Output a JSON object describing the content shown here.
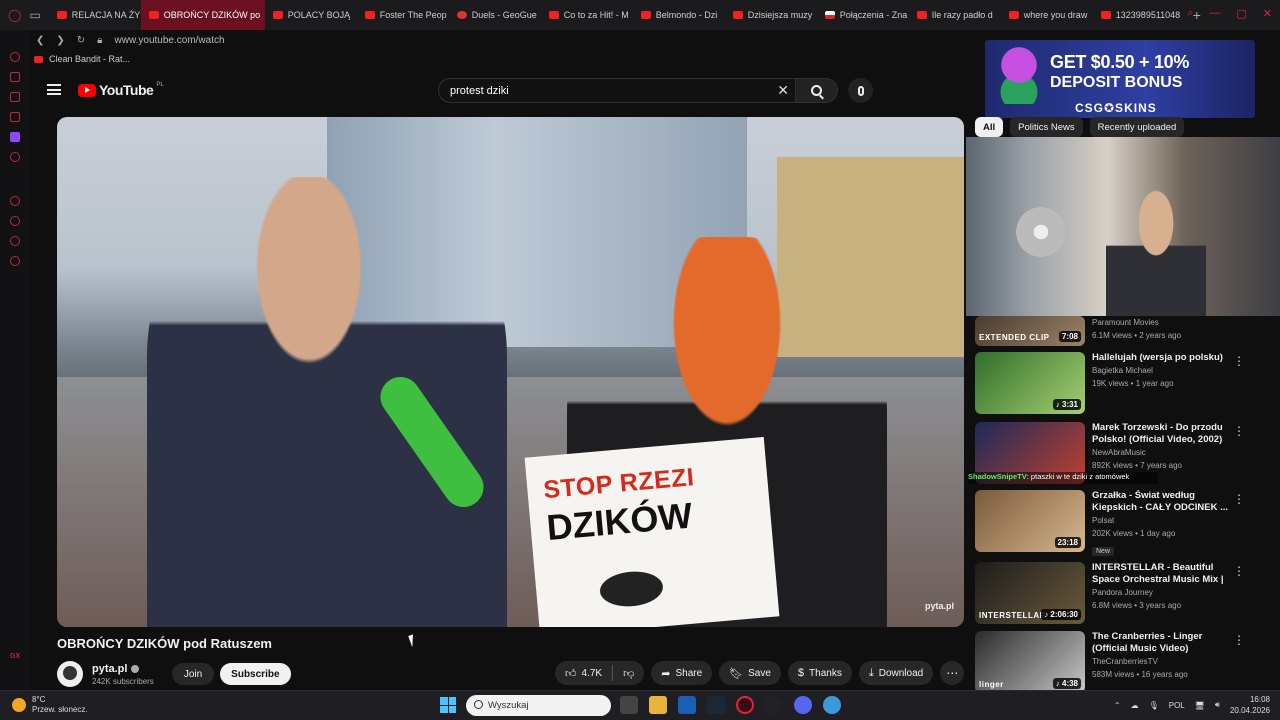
{
  "browser": {
    "tabs": [
      {
        "label": "RELACJA NA ŻY",
        "active": false
      },
      {
        "label": "OBROŃCY DZIKÓW po",
        "active": true
      },
      {
        "label": "POLACY BOJĄ",
        "active": false
      },
      {
        "label": "Foster The Peop",
        "active": false
      },
      {
        "label": "Duels - GeoGue",
        "active": false
      },
      {
        "label": "Co to za Hit! - M",
        "active": false
      },
      {
        "label": "Belmondo - Dzi",
        "active": false
      },
      {
        "label": "Dzisiejsza muzy",
        "active": false
      },
      {
        "label": "Połączenia - Zna",
        "active": false
      },
      {
        "label": "Ile razy padło d",
        "active": false
      },
      {
        "label": "where you draw",
        "active": false
      },
      {
        "label": "1323989511048",
        "active": false
      }
    ],
    "new_tab": "+",
    "url": "www.youtube.com/watch",
    "bookmark": "Clean Bandit - Rat...",
    "sidebar_badge": "GX"
  },
  "youtube": {
    "logo_word": "YouTube",
    "logo_country": "PL",
    "search_value": "protest dziki",
    "video": {
      "sign_line1": "STOP RZEZI",
      "sign_line2": "DZIKÓW",
      "watermark": "pyta.pl",
      "title": "OBROŃCY DZIKÓW pod Ratuszem"
    },
    "channel": {
      "name": "pyta.pl",
      "subscribers": "242K subscribers",
      "join_label": "Join",
      "subscribe_label": "Subscribe"
    },
    "actions": {
      "likes": "4.7K",
      "share": "Share",
      "save": "Save",
      "thanks": "Thanks",
      "download": "Download"
    },
    "chips": [
      "All",
      "Politics News",
      "Recently uploaded"
    ],
    "ad": {
      "line1": "GET $0.50 + 10%",
      "line2": "DEPOSIT BONUS",
      "brand": "CSG✪SKINS"
    },
    "overlay_chat": {
      "user": "ShadowSnipeTV",
      "message": ": ptaszki w te dziki z atomówek"
    },
    "recommendations": [
      {
        "title": "",
        "channel": "Paramount Movies",
        "meta": "6.1M views • 2 years ago",
        "duration": "7:08",
        "thumb_text": "EXTENDED CLIP",
        "badge": "",
        "color1": "#4a3b2e",
        "color2": "#9b8467"
      },
      {
        "title": "Hallelujah (wersja po polsku)",
        "channel": "Bagietka Michael",
        "meta": "19K views • 1 year ago",
        "duration": "♪ 3:31",
        "thumb_text": "",
        "badge": "",
        "color1": "#2f6e2a",
        "color2": "#a7cf72"
      },
      {
        "title": "Marek Torzewski - Do przodu Polsko! (Official Video, 2002)",
        "channel": "NewAbraMusic",
        "meta": "892K views • 7 years ago",
        "duration": "",
        "thumb_text": "",
        "badge": "",
        "color1": "#1a2a5a",
        "color2": "#c04030"
      },
      {
        "title": "Grzałka - Świat według Kiepskich - CAŁY ODCINEK ...",
        "channel": "Polsat",
        "meta": "202K views • 1 day ago",
        "duration": "23:18",
        "thumb_text": "",
        "badge": "New",
        "color1": "#7a5a3a",
        "color2": "#d8b890"
      },
      {
        "title": "INTERSTELLAR - Beautiful Space Orchestral Music Mix | ...",
        "channel": "Pandora Journey",
        "meta": "6.8M views • 3 years ago",
        "duration": "♪ 2:06:30",
        "thumb_text": "INTERSTELLAR",
        "badge": "",
        "color1": "#1c1c1c",
        "color2": "#6a5a3a"
      },
      {
        "title": "The Cranberries - Linger (Official Music Video)",
        "channel": "TheCranberriesTV",
        "meta": "583M views • 16 years ago",
        "duration": "♪ 4:38",
        "thumb_text": "linger",
        "badge": "",
        "color1": "#2a2a2a",
        "color2": "#c8c8c8"
      }
    ]
  },
  "taskbar": {
    "temperature": "8°C",
    "weather": "Przew. słonecz.",
    "notification_count": "1",
    "search_placeholder": "Wyszukaj",
    "language": "POL",
    "time": "16:08",
    "date": "20.04.2026"
  }
}
